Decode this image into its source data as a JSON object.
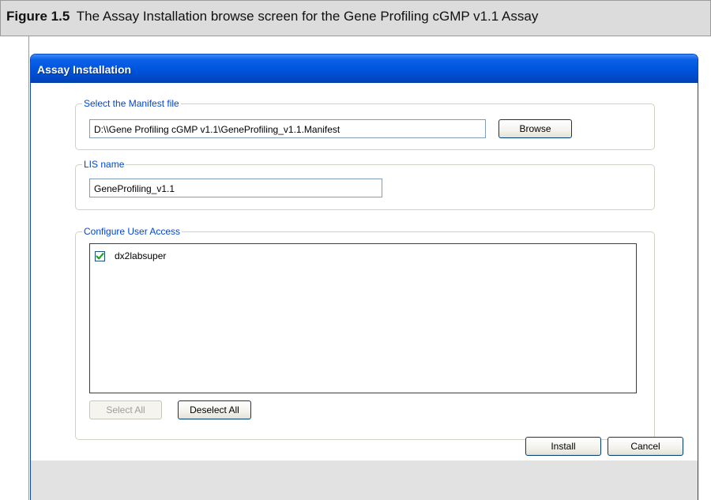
{
  "figure": {
    "label": "Figure 1.5",
    "caption": "The Assay Installation browse screen for the Gene Profiling cGMP v1.1 Assay"
  },
  "window": {
    "title": "Assay Installation"
  },
  "manifest_group": {
    "legend": "Select the Manifest file",
    "path_value": "D:\\\\Gene Profiling cGMP v1.1\\GeneProfiling_v1.1.Manifest",
    "browse_label": "Browse"
  },
  "lis_group": {
    "legend": "LIS name",
    "name_value": "GeneProfiling_v1.1"
  },
  "access_group": {
    "legend": "Configure User Access",
    "users": [
      {
        "name": "dx2labsuper",
        "checked": true
      }
    ],
    "select_all_label": "Select All",
    "deselect_all_label": "Deselect All"
  },
  "footer": {
    "install_label": "Install",
    "cancel_label": "Cancel"
  },
  "colors": {
    "titlebar": "#0055de",
    "legend_text": "#0046d5",
    "checkmark": "#21a121"
  }
}
